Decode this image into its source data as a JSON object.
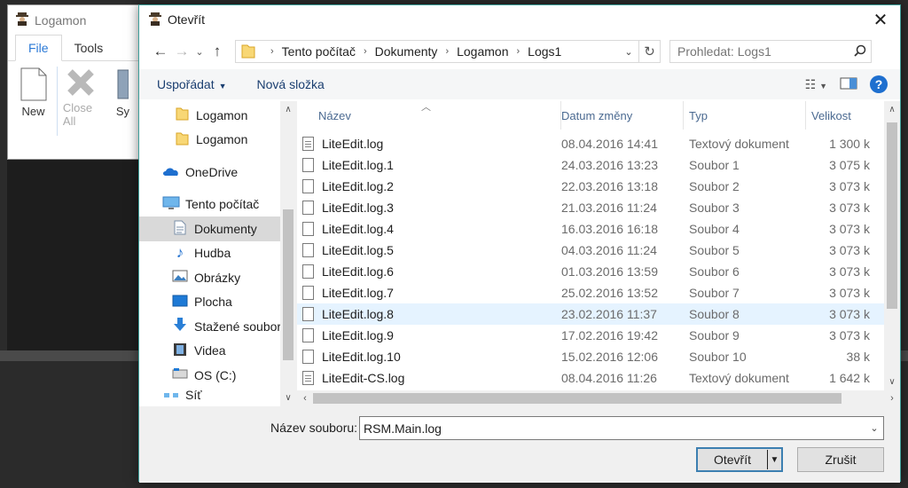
{
  "background_app": {
    "title": "Logamon",
    "tabs": [
      "File",
      "Tools"
    ],
    "ribbon": {
      "new_label": "New",
      "close_all_label": "Close All",
      "partial_label": "Sy"
    }
  },
  "dialog": {
    "title": "Otevřít",
    "address": {
      "crumbs": [
        "Tento počítač",
        "Dokumenty",
        "Logamon",
        "Logs1"
      ]
    },
    "search": {
      "placeholder": "Prohledat: Logs1"
    },
    "commands": {
      "organize": "Uspořádat",
      "new_folder": "Nová složka"
    },
    "nav_pane": {
      "items": [
        {
          "label": "Logamon",
          "icon": "folder-icon"
        },
        {
          "label": "Logamon",
          "icon": "folder-icon"
        },
        {
          "label": "OneDrive",
          "icon": "onedrive-icon"
        },
        {
          "label": "Tento počítač",
          "icon": "computer-icon"
        },
        {
          "label": "Dokumenty",
          "icon": "documents-icon",
          "selected": true
        },
        {
          "label": "Hudba",
          "icon": "music-icon"
        },
        {
          "label": "Obrázky",
          "icon": "pictures-icon"
        },
        {
          "label": "Plocha",
          "icon": "desktop-icon"
        },
        {
          "label": "Stažené soubory",
          "icon": "downloads-icon"
        },
        {
          "label": "Videa",
          "icon": "videos-icon"
        },
        {
          "label": "OS (C:)",
          "icon": "drive-icon"
        },
        {
          "label": "Síť",
          "icon": "network-icon"
        }
      ]
    },
    "columns": [
      "Název",
      "Datum změny",
      "Typ",
      "Velikost"
    ],
    "files": [
      {
        "name": "LiteEdit.log",
        "date": "08.04.2016 14:41",
        "type": "Textový dokument",
        "size": "1 300 k"
      },
      {
        "name": "LiteEdit.log.1",
        "date": "24.03.2016 13:23",
        "type": "Soubor 1",
        "size": "3 075 k"
      },
      {
        "name": "LiteEdit.log.2",
        "date": "22.03.2016 13:18",
        "type": "Soubor 2",
        "size": "3 073 k"
      },
      {
        "name": "LiteEdit.log.3",
        "date": "21.03.2016 11:24",
        "type": "Soubor 3",
        "size": "3 073 k"
      },
      {
        "name": "LiteEdit.log.4",
        "date": "16.03.2016 16:18",
        "type": "Soubor 4",
        "size": "3 073 k"
      },
      {
        "name": "LiteEdit.log.5",
        "date": "04.03.2016 11:24",
        "type": "Soubor 5",
        "size": "3 073 k"
      },
      {
        "name": "LiteEdit.log.6",
        "date": "01.03.2016 13:59",
        "type": "Soubor 6",
        "size": "3 073 k"
      },
      {
        "name": "LiteEdit.log.7",
        "date": "25.02.2016 13:52",
        "type": "Soubor 7",
        "size": "3 073 k"
      },
      {
        "name": "LiteEdit.log.8",
        "date": "23.02.2016 11:37",
        "type": "Soubor 8",
        "size": "3 073 k",
        "hover": true
      },
      {
        "name": "LiteEdit.log.9",
        "date": "17.02.2016 19:42",
        "type": "Soubor 9",
        "size": "3 073 k"
      },
      {
        "name": "LiteEdit.log.10",
        "date": "15.02.2016 12:06",
        "type": "Soubor 10",
        "size": "38 k"
      },
      {
        "name": "LiteEdit-CS.log",
        "date": "08.04.2016 11:26",
        "type": "Textový dokument",
        "size": "1 642 k"
      }
    ],
    "filename": {
      "label": "Název souboru:",
      "value": "RSM.Main.log"
    },
    "buttons": {
      "open": "Otevřít",
      "cancel": "Zrušit"
    }
  }
}
